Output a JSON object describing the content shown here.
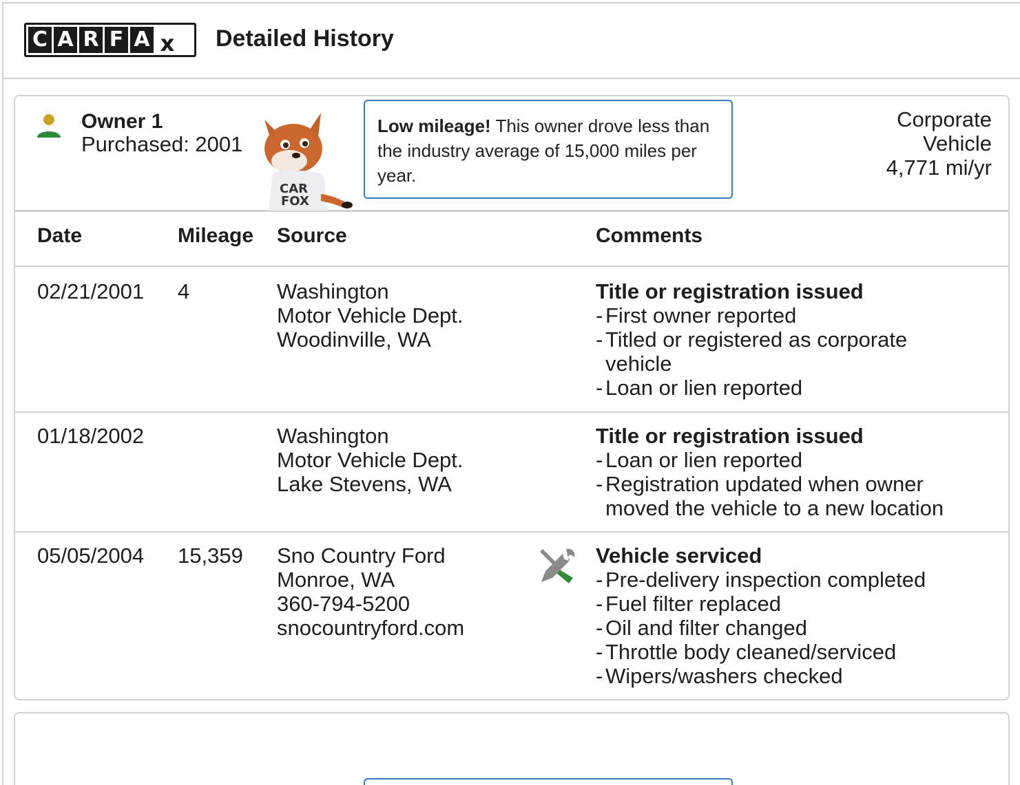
{
  "header": {
    "logo_letters": [
      "C",
      "A",
      "R",
      "F",
      "A",
      "x"
    ],
    "title": "Detailed History"
  },
  "owner": {
    "label": "Owner 1",
    "purchased": "Purchased: 2001",
    "callout_bold": "Low mileage!",
    "callout_text": "This owner drove less than the industry average of 15,000 miles per year.",
    "vehicle_type_line1": "Corporate",
    "vehicle_type_line2": "Vehicle",
    "mileage_rate": "4,771 mi/yr"
  },
  "table": {
    "headers": [
      "Date",
      "Mileage",
      "Source",
      "Comments"
    ],
    "rows": [
      {
        "date": "02/21/2001",
        "mileage": "4",
        "source": [
          "Washington",
          "Motor Vehicle Dept.",
          "Woodinville, WA"
        ],
        "comment_title": "Title or registration issued",
        "comments": [
          "First owner reported",
          "Titled or registered as corporate vehicle",
          "Loan or lien reported"
        ]
      },
      {
        "date": "01/18/2002",
        "mileage": "",
        "source": [
          "Washington",
          "Motor Vehicle Dept.",
          "Lake Stevens, WA"
        ],
        "comment_title": "Title or registration issued",
        "comments": [
          "Loan or lien reported",
          "Registration updated when owner moved the vehicle to a new location"
        ]
      },
      {
        "date": "05/05/2004",
        "mileage": "15,359",
        "source": [
          "Sno Country Ford",
          "Monroe, WA",
          "360-794-5200",
          "snocountryford.com"
        ],
        "comment_title": "Vehicle serviced",
        "comments": [
          "Pre-delivery inspection completed",
          "Fuel filter replaced",
          "Oil and filter changed",
          "Throttle body cleaned/serviced",
          "Wipers/washers checked"
        ]
      }
    ]
  },
  "colors": {
    "accent_blue": "#3777bc",
    "icon_green": "#2e8b3a",
    "icon_gold": "#c9a227",
    "border_gray": "#d3d3d3"
  }
}
